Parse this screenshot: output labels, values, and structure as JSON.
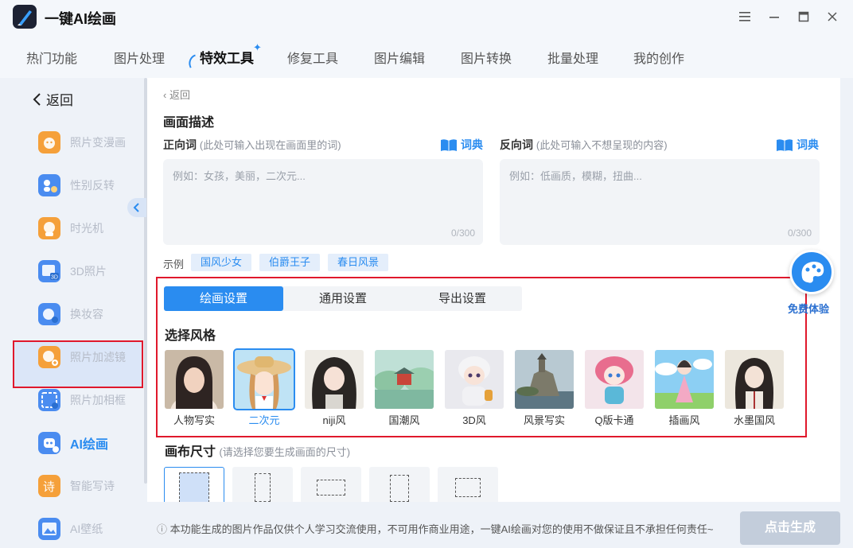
{
  "app": {
    "title": "一键AI绘画"
  },
  "window_controls": [
    "menu-icon",
    "minimize-icon",
    "maximize-icon",
    "close-icon"
  ],
  "nav": {
    "tabs": [
      "热门功能",
      "图片处理",
      "特效工具",
      "修复工具",
      "图片编辑",
      "图片转换",
      "批量处理",
      "我的创作"
    ],
    "active": "特效工具"
  },
  "sidebar": {
    "back": "返回",
    "items": [
      {
        "label": "照片变漫画",
        "icon": "cartoon-face-icon",
        "color": "#f5a03a"
      },
      {
        "label": "性别反转",
        "icon": "gender-swap-icon",
        "color": "#4a8cf0"
      },
      {
        "label": "时光机",
        "icon": "time-machine-icon",
        "color": "#f5a03a"
      },
      {
        "label": "3D照片",
        "icon": "3d-photo-icon",
        "color": "#4a8cf0"
      },
      {
        "label": "换妆容",
        "icon": "makeup-icon",
        "color": "#4a8cf0"
      },
      {
        "label": "照片加滤镜",
        "icon": "filter-icon",
        "color": "#f5a03a"
      },
      {
        "label": "照片加相框",
        "icon": "frame-icon",
        "color": "#4a8cf0"
      },
      {
        "label": "AI绘画",
        "icon": "ai-painting-icon",
        "color": "#4a8cf0"
      },
      {
        "label": "智能写诗",
        "icon": "poem-icon",
        "color": "#f5a03a"
      },
      {
        "label": "AI壁纸",
        "icon": "wallpaper-icon",
        "color": "#4a8cf0"
      }
    ],
    "active": "AI绘画"
  },
  "main": {
    "breadcrumb": "返回",
    "prompt_section": "画面描述",
    "positive": {
      "label": "正向词",
      "hint": "(此处可输入出现在画面里的词)",
      "dict": "词典",
      "placeholder": "例如：女孩，美丽，二次元...",
      "count": "0/300"
    },
    "negative": {
      "label": "反向词",
      "hint": "(此处可输入不想呈现的内容)",
      "dict": "词典",
      "placeholder": "例如：低画质，模糊，扭曲...",
      "count": "0/300"
    },
    "examples_label": "示例",
    "examples": [
      "国风少女",
      "伯爵王子",
      "春日风景"
    ],
    "settings_tabs": [
      "绘画设置",
      "通用设置",
      "导出设置"
    ],
    "active_settings_tab": "绘画设置",
    "style_title": "选择风格",
    "styles": [
      {
        "label": "人物写实",
        "icon": "realistic-portrait-thumb"
      },
      {
        "label": "二次元",
        "icon": "anime-thumb"
      },
      {
        "label": "niji风",
        "icon": "niji-thumb"
      },
      {
        "label": "国潮风",
        "icon": "guochao-thumb"
      },
      {
        "label": "3D风",
        "icon": "3d-style-thumb"
      },
      {
        "label": "风景写实",
        "icon": "landscape-thumb"
      },
      {
        "label": "Q版卡通",
        "icon": "chibi-thumb"
      },
      {
        "label": "插画风",
        "icon": "illustration-thumb"
      },
      {
        "label": "水墨国风",
        "icon": "ink-thumb"
      }
    ],
    "selected_style": "二次元",
    "canvas_title": "画布尺寸",
    "canvas_hint": "(请选择您要生成画面的尺寸)"
  },
  "trial": {
    "label": "免费体验"
  },
  "footer": {
    "notice": "本功能生成的图片作品仅供个人学习交流使用，不可用作商业用途，一键AI绘画对您的使用不做保证且不承担任何责任~",
    "generate": "点击生成"
  },
  "colors": {
    "accent": "#2a8cf0",
    "highlight_border": "#e0182c",
    "disabled_button": "#c3cddb"
  }
}
